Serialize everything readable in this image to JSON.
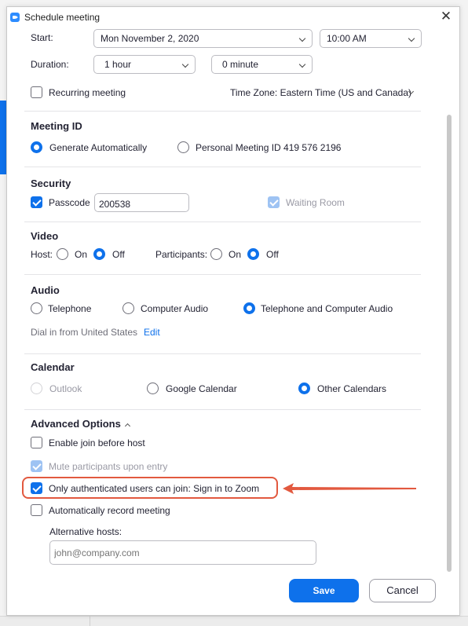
{
  "window": {
    "title": "Schedule meeting"
  },
  "schedule": {
    "start_label": "Start:",
    "start_date": "Mon  November  2,  2020",
    "start_time": "10:00  AM",
    "duration_label": "Duration:",
    "duration_hours": "1 hour",
    "duration_minutes": "0 minute",
    "recurring_label": "Recurring meeting",
    "recurring_checked": false,
    "timezone": "Time Zone: Eastern Time (US and Canada)"
  },
  "meeting_id": {
    "title": "Meeting ID",
    "generate_label": "Generate Automatically",
    "personal_label": "Personal Meeting ID 419 576 2196",
    "selected": "generate"
  },
  "security": {
    "title": "Security",
    "passcode_label": "Passcode",
    "passcode_checked": true,
    "passcode_value": "200538",
    "waiting_room_label": "Waiting Room",
    "waiting_room_checked": true,
    "waiting_room_disabled": true
  },
  "video": {
    "title": "Video",
    "host_label": "Host:",
    "participants_label": "Participants:",
    "on_label": "On",
    "off_label": "Off",
    "host_selected": "off",
    "participants_selected": "off"
  },
  "audio": {
    "title": "Audio",
    "options": [
      "Telephone",
      "Computer Audio",
      "Telephone and Computer Audio"
    ],
    "selected": "Telephone and Computer Audio",
    "dial_in_text": "Dial in from United States",
    "edit_link": "Edit"
  },
  "calendar": {
    "title": "Calendar",
    "options": [
      "Outlook",
      "Google Calendar",
      "Other Calendars"
    ],
    "selected": "Other Calendars",
    "disabled": [
      "Outlook"
    ]
  },
  "advanced": {
    "title": "Advanced Options",
    "join_before_host_label": "Enable join before host",
    "join_before_host_checked": false,
    "mute_on_entry_label": "Mute participants upon entry",
    "mute_on_entry_checked": true,
    "mute_on_entry_disabled": true,
    "auth_only_label": "Only authenticated users can join: Sign in to Zoom",
    "auth_only_checked": true,
    "auto_record_label": "Automatically record meeting",
    "auto_record_checked": false,
    "alt_hosts_label": "Alternative hosts:",
    "alt_hosts_placeholder": "john@company.com"
  },
  "actions": {
    "save_label": "Save",
    "cancel_label": "Cancel"
  },
  "colors": {
    "accent": "#0e71eb",
    "highlight": "#e2593f",
    "disabled_text": "#9a9aa5"
  },
  "icons": {
    "app": "zoom-video-icon",
    "close": "close-icon",
    "dropdown": "chevron-down-icon",
    "collapse": "chevron-up-icon",
    "annotation": "arrow-left-icon"
  }
}
